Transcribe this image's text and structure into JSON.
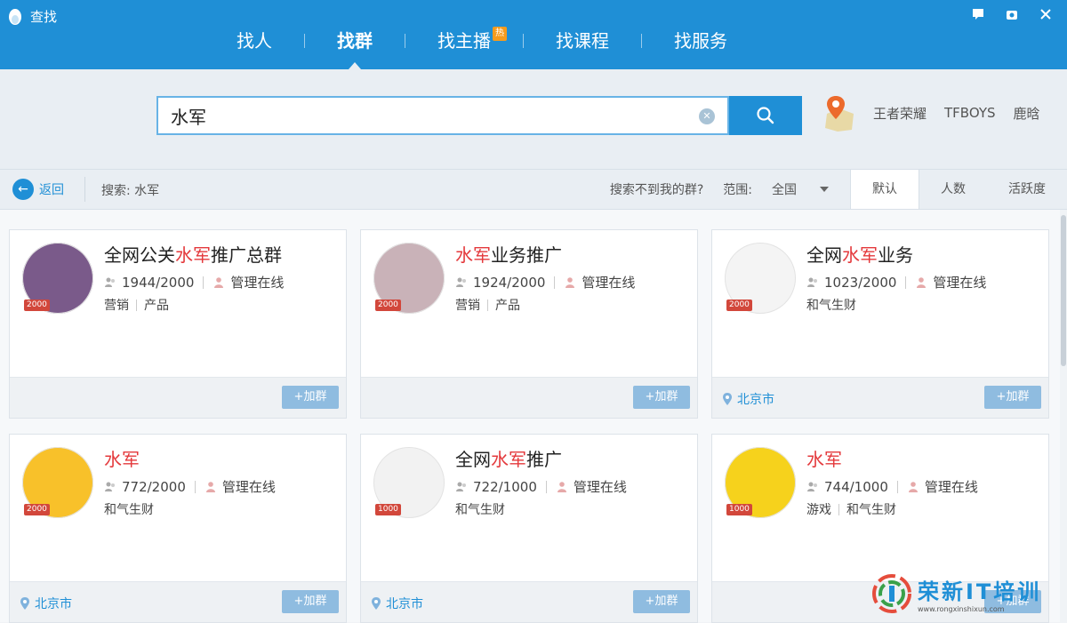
{
  "app": {
    "title": "查找"
  },
  "nav_tabs": [
    {
      "label": "找人"
    },
    {
      "label": "找群",
      "active": true
    },
    {
      "label": "找主播",
      "badge": "热"
    },
    {
      "label": "找课程"
    },
    {
      "label": "找服务"
    }
  ],
  "search": {
    "query": "水军",
    "clear_icon": "clear-icon",
    "button_icon": "search-icon"
  },
  "hot_searches": [
    "王者荣耀",
    "TFBOYS",
    "鹿晗"
  ],
  "filter": {
    "back_label": "返回",
    "summary": "搜索: 水军",
    "not_found_label": "搜索不到我的群?",
    "scope_label": "范围:",
    "scope_value": "全国",
    "sort_tabs": [
      "默认",
      "人数",
      "活跃度"
    ],
    "active_sort": "默认"
  },
  "groups": [
    {
      "title_pre": "全网公关",
      "title_hl": "水军",
      "title_post": "推广总群",
      "members": "1944/2000",
      "admin": "管理在线",
      "tags": [
        "营销",
        "产品"
      ],
      "location": "",
      "level": "2000",
      "join_label": "+加群",
      "avatar_color": "#7a5a8a"
    },
    {
      "title_pre": "",
      "title_hl": "水军",
      "title_post": "业务推广",
      "members": "1924/2000",
      "admin": "管理在线",
      "tags": [
        "营销",
        "产品"
      ],
      "location": "",
      "level": "2000",
      "join_label": "+加群",
      "avatar_color": "#c9b2b8"
    },
    {
      "title_pre": "全网",
      "title_hl": "水军",
      "title_post": "业务",
      "members": "1023/2000",
      "admin": "管理在线",
      "tags": [
        "和气生财"
      ],
      "location": "北京市",
      "level": "2000",
      "join_label": "+加群",
      "avatar_color": "#f4f4f4"
    },
    {
      "title_pre": "",
      "title_hl": "水军",
      "title_post": "",
      "members": "772/2000",
      "admin": "管理在线",
      "tags": [
        "和气生财"
      ],
      "location": "北京市",
      "level": "2000",
      "join_label": "+加群",
      "avatar_color": "#f8c12a"
    },
    {
      "title_pre": "全网",
      "title_hl": "水军",
      "title_post": "推广",
      "members": "722/1000",
      "admin": "管理在线",
      "tags": [
        "和气生财"
      ],
      "location": "北京市",
      "level": "1000",
      "join_label": "+加群",
      "avatar_color": "#f2f2f2"
    },
    {
      "title_pre": "",
      "title_hl": "水军",
      "title_post": "",
      "members": "744/1000",
      "admin": "管理在线",
      "tags": [
        "游戏",
        "和气生财"
      ],
      "location": "",
      "level": "1000",
      "join_label": "+加群",
      "avatar_color": "#f6d21c"
    }
  ],
  "watermark": {
    "main": "荣新IT培训",
    "sub": "www.rongxinshixun.com"
  },
  "colors": {
    "brand": "#1f8fd6",
    "highlight": "#e4393c",
    "join": "#8fbce0"
  }
}
